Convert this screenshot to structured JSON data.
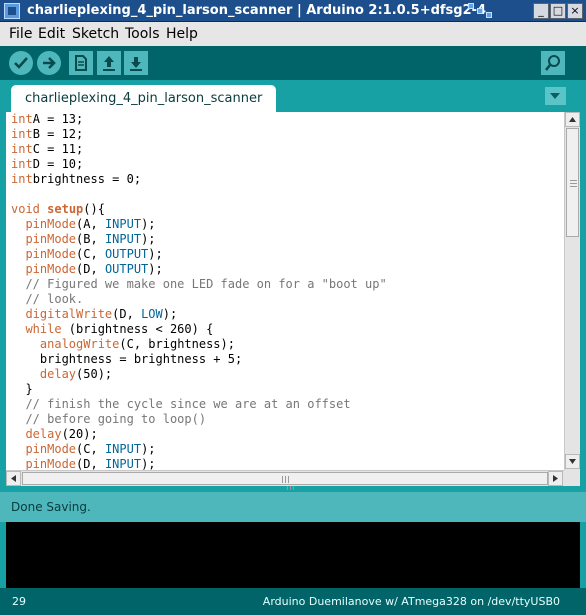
{
  "window": {
    "title": "charlieplexing_4_pin_larson_scanner | Arduino 2:1.0.5+dfsg2-4"
  },
  "window_controls": {
    "minimize": "_",
    "maximize": "□",
    "close": "×"
  },
  "menu": [
    "File",
    "Edit",
    "Sketch",
    "Tools",
    "Help"
  ],
  "toolbar": {
    "buttons": [
      "verify-icon",
      "upload-icon",
      "new-icon",
      "open-icon",
      "save-icon"
    ],
    "right_button": "serial-monitor-icon"
  },
  "tabs": [
    {
      "label": "charlieplexing_4_pin_larson_scanner",
      "active": true
    }
  ],
  "code": [
    [
      [
        "kw-type",
        "int"
      ],
      [
        "",
        "A = 13;"
      ]
    ],
    [
      [
        "kw-type",
        "int"
      ],
      [
        "",
        "B = 12;"
      ]
    ],
    [
      [
        "kw-type",
        "int"
      ],
      [
        "",
        "C = 11;"
      ]
    ],
    [
      [
        "kw-type",
        "int"
      ],
      [
        "",
        "D = 10;"
      ]
    ],
    [
      [
        "kw-type",
        "int"
      ],
      [
        "",
        "brightness = 0;"
      ]
    ],
    [],
    [
      [
        "kw-type",
        "void"
      ],
      [
        "",
        " "
      ],
      [
        "fn-bold",
        "setup"
      ],
      [
        "",
        "(){"
      ]
    ],
    [
      [
        "",
        "  "
      ],
      [
        "fn",
        "pinMode"
      ],
      [
        "",
        "(A, "
      ],
      [
        "const",
        "INPUT"
      ],
      [
        "",
        ");"
      ]
    ],
    [
      [
        "",
        "  "
      ],
      [
        "fn",
        "pinMode"
      ],
      [
        "",
        "(B, "
      ],
      [
        "const",
        "INPUT"
      ],
      [
        "",
        ");"
      ]
    ],
    [
      [
        "",
        "  "
      ],
      [
        "fn",
        "pinMode"
      ],
      [
        "",
        "(C, "
      ],
      [
        "const",
        "OUTPUT"
      ],
      [
        "",
        ");"
      ]
    ],
    [
      [
        "",
        "  "
      ],
      [
        "fn",
        "pinMode"
      ],
      [
        "",
        "(D, "
      ],
      [
        "const",
        "OUTPUT"
      ],
      [
        "",
        ");"
      ]
    ],
    [
      [
        "",
        "  "
      ],
      [
        "cmt",
        "// Figured we make one LED fade on for a \"boot up\""
      ]
    ],
    [
      [
        "",
        "  "
      ],
      [
        "cmt",
        "// look."
      ]
    ],
    [
      [
        "",
        "  "
      ],
      [
        "fn",
        "digitalWrite"
      ],
      [
        "",
        "(D, "
      ],
      [
        "const",
        "LOW"
      ],
      [
        "",
        ");"
      ]
    ],
    [
      [
        "",
        "  "
      ],
      [
        "kw",
        "while"
      ],
      [
        "",
        " (brightness < 260) {"
      ]
    ],
    [
      [
        "",
        "    "
      ],
      [
        "fn",
        "analogWrite"
      ],
      [
        "",
        "(C, brightness);"
      ]
    ],
    [
      [
        "",
        "    brightness = brightness + 5;"
      ]
    ],
    [
      [
        "",
        "    "
      ],
      [
        "fn",
        "delay"
      ],
      [
        "",
        "(50);"
      ]
    ],
    [
      [
        "",
        "  }"
      ]
    ],
    [
      [
        "",
        "  "
      ],
      [
        "cmt",
        "// finish the cycle since we are at an offset"
      ]
    ],
    [
      [
        "",
        "  "
      ],
      [
        "cmt",
        "// before going to loop()"
      ]
    ],
    [
      [
        "",
        "  "
      ],
      [
        "fn",
        "delay"
      ],
      [
        "",
        "(20);"
      ]
    ],
    [
      [
        "",
        "  "
      ],
      [
        "fn",
        "pinMode"
      ],
      [
        "",
        "(C, "
      ],
      [
        "const",
        "INPUT"
      ],
      [
        "",
        ");"
      ]
    ],
    [
      [
        "",
        "  "
      ],
      [
        "fn",
        "pinMode"
      ],
      [
        "",
        "(D, "
      ],
      [
        "const",
        "INPUT"
      ],
      [
        "",
        ");"
      ]
    ]
  ],
  "status": {
    "message": "Done Saving."
  },
  "footer": {
    "line_number": "29",
    "board": "Arduino Duemilanove w/ ATmega328 on /dev/ttyUSB0"
  },
  "colors": {
    "toolbar": "#006468",
    "tabbar": "#17a1a5",
    "status": "#4db7bb",
    "keyword": "#cc6633",
    "constant": "#006699",
    "comment": "#777777"
  }
}
